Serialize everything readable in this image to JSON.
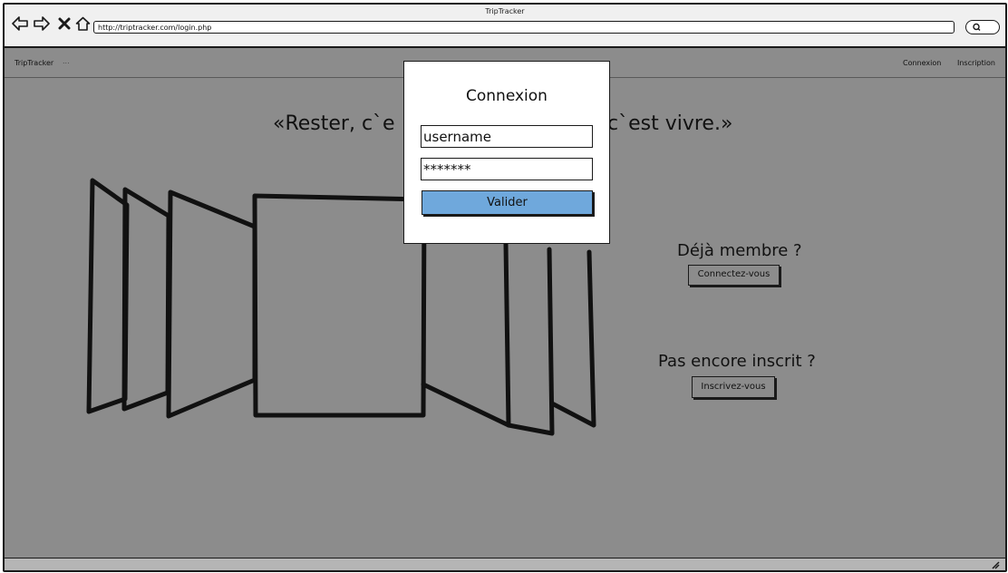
{
  "browser": {
    "title": "TripTracker",
    "url": "http://triptracker.com/login.php"
  },
  "navbar": {
    "brand": "TripTracker",
    "brand_suffix": "...",
    "links": [
      "Connexion",
      "Inscription"
    ]
  },
  "main": {
    "quote_left": "«Rester, c`e",
    "quote_right": "c`est vivre.»",
    "member_heading": "Déjà membre ?",
    "member_button": "Connectez-vous",
    "signup_heading": "Pas encore inscrit ?",
    "signup_button": "Inscrivez-vous"
  },
  "modal": {
    "title": "Connexion",
    "username_value": "username",
    "password_value": "*******",
    "submit_label": "Valider"
  },
  "colors": {
    "overlay_gray": "#8c8c8c",
    "submit_blue": "#6fa8dc",
    "ink": "#1a1a1a"
  },
  "icons": [
    "back-arrow-icon",
    "forward-arrow-icon",
    "close-icon",
    "home-icon",
    "search-icon",
    "resize-grip-icon"
  ]
}
